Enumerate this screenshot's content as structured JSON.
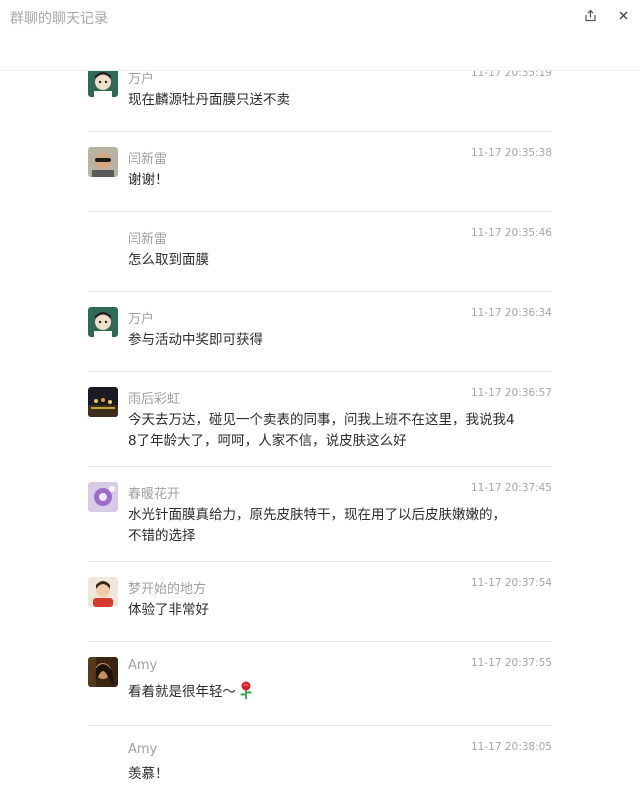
{
  "window": {
    "title": "群聊的聊天记录",
    "share_icon": "share-icon",
    "close_icon": "close-icon"
  },
  "messages": [
    {
      "name": "万户",
      "time": "11-17 20:35:19",
      "avatar": "cartoon-boy",
      "lines": [
        "现在麟源牡丹面膜只送不卖"
      ]
    },
    {
      "name": "闫新雷",
      "time": "11-17 20:35:38",
      "avatar": "man-sunglasses",
      "lines": [
        "谢谢！"
      ]
    },
    {
      "name": "闫新雷",
      "time": "11-17 20:35:46",
      "avatar": "none",
      "lines": [
        "怎么取到面膜"
      ]
    },
    {
      "name": "万户",
      "time": "11-17 20:36:34",
      "avatar": "cartoon-boy",
      "lines": [
        "参与活动中奖即可获得"
      ]
    },
    {
      "name": "雨后彩虹",
      "time": "11-17 20:36:57",
      "avatar": "night-lights",
      "lines": [
        "今天去万达，碰见一个卖表的同事，问我上班不在这里，我说我4",
        "8了年龄大了，呵呵，人家不信，说皮肤这么好"
      ]
    },
    {
      "name": "春暖花开",
      "time": "11-17 20:37:45",
      "avatar": "purple-flower",
      "lines": [
        "水光针面膜真给力，原先皮肤特干，现在用了以后皮肤嫩嫩的，",
        "不错的选择"
      ]
    },
    {
      "name": "梦开始的地方",
      "time": "11-17 20:37:54",
      "avatar": "girl-red",
      "lines": [
        "体验了非常好"
      ]
    },
    {
      "name": "Amy",
      "time": "11-17 20:37:55",
      "avatar": "woman-dark",
      "lines": [
        "看着就是很年轻～"
      ],
      "emoji": "rose-icon"
    },
    {
      "name": "Amy",
      "time": "11-17 20:38:05",
      "avatar": "none",
      "lines": [
        "羡慕！"
      ]
    }
  ]
}
